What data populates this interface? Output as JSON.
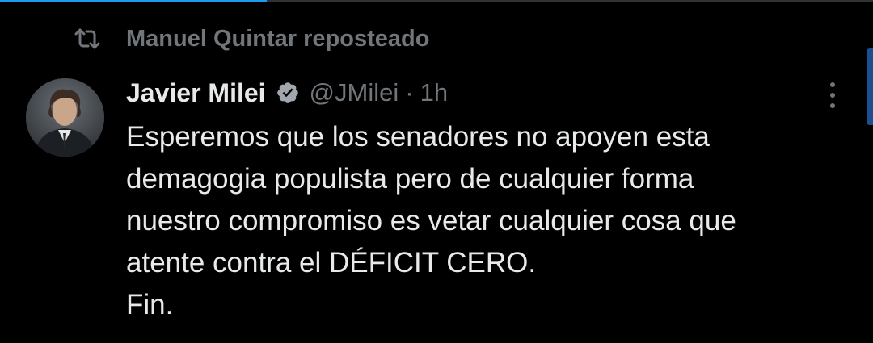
{
  "repost": {
    "icon": "repost-icon",
    "text": "Manuel Quintar reposteado"
  },
  "author": {
    "name": "Javier Milei",
    "verified_icon": "verified-badge-icon",
    "handle": "@JMilei",
    "separator": "·",
    "time": "1h"
  },
  "tweet": {
    "lines": [
      "Esperemos que los senadores no apoyen esta",
      "demagogia populista pero de cualquier forma",
      "nuestro compromiso es vetar cualquier cosa que",
      "atente contra el DÉFICIT CERO.",
      "Fin."
    ]
  },
  "more_menu": {
    "icon": "more-vertical-icon"
  },
  "colors": {
    "background": "#000000",
    "text_primary": "#e7e9ea",
    "text_secondary": "#71767b",
    "accent": "#1d9bf0"
  }
}
